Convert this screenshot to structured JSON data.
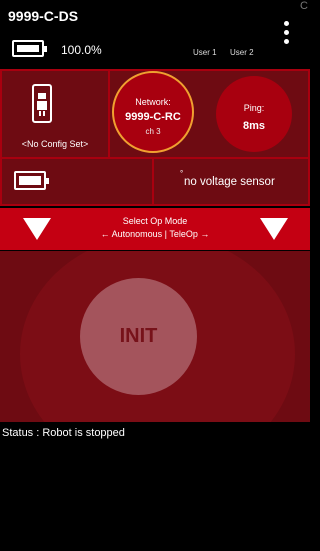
{
  "app": {
    "title": "9999-C-DS",
    "corner_letter": "C"
  },
  "header": {
    "battery_percent": "100.0%",
    "user1": "User 1",
    "user2": "User 2",
    "menu_icon": "kebab-menu-icon"
  },
  "config": {
    "label": "<No Config Set>",
    "icon": "robot-phone-icon"
  },
  "network": {
    "title": "Network:",
    "name": "9999-C-RC",
    "channel": "ch 3"
  },
  "ping": {
    "title": "Ping:",
    "value": "8ms"
  },
  "rc_battery": {
    "icon": "battery-icon"
  },
  "voltage": {
    "text": "no voltage sensor"
  },
  "op_mode": {
    "title": "Select Op Mode",
    "subtitle": "← Autonomous | TeleOp →"
  },
  "init": {
    "label": "INIT"
  },
  "status": {
    "text": "Status : Robot is stopped"
  },
  "colors": {
    "accent_red": "#c40012",
    "panel_red": "#a8000f",
    "dark_red": "#6e0b12",
    "init_button": "#a4545c",
    "network_ring": "#f0a030"
  }
}
